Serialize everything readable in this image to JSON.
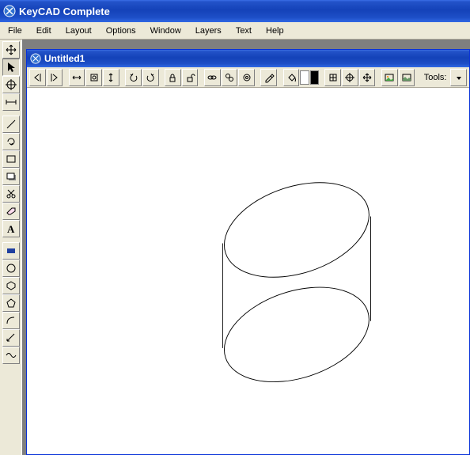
{
  "app": {
    "title": "KeyCAD Complete"
  },
  "menu": {
    "file": "File",
    "edit": "Edit",
    "layout": "Layout",
    "options": "Options",
    "window": "Window",
    "layers": "Layers",
    "text": "Text",
    "help": "Help"
  },
  "doc": {
    "title": "Untitled1",
    "toolbar_label": "Tools:"
  },
  "left_tools": [
    "cursor-move",
    "pointer",
    "registration",
    "divider-h",
    "line",
    "circle-arrow",
    "rect",
    "rect-shadow",
    "scissors",
    "eraser",
    "text-A"
  ],
  "shape_tools": [
    "rect-filled",
    "circle-outline",
    "hexagon",
    "polygon",
    "arc",
    "measure",
    "wave"
  ],
  "doc_tools_1": [
    "scroll-left",
    "scroll-right"
  ],
  "doc_tools_2": [
    "fit-width",
    "fit-both",
    "fit-height"
  ],
  "doc_tools_3": [
    "rotate-left",
    "rotate-right"
  ],
  "doc_tools_4": [
    "lock",
    "unlock"
  ],
  "doc_tools_5": [
    "link",
    "chain",
    "ring"
  ],
  "doc_tools_6": [
    "eyedropper"
  ],
  "doc_tools_7": [
    "fill-bucket"
  ],
  "colors": {
    "white": "#ffffff",
    "black": "#000000"
  },
  "doc_tools_8": [
    "grid",
    "crosshair",
    "move-all"
  ],
  "doc_tools_9": [
    "image",
    "landscape"
  ]
}
